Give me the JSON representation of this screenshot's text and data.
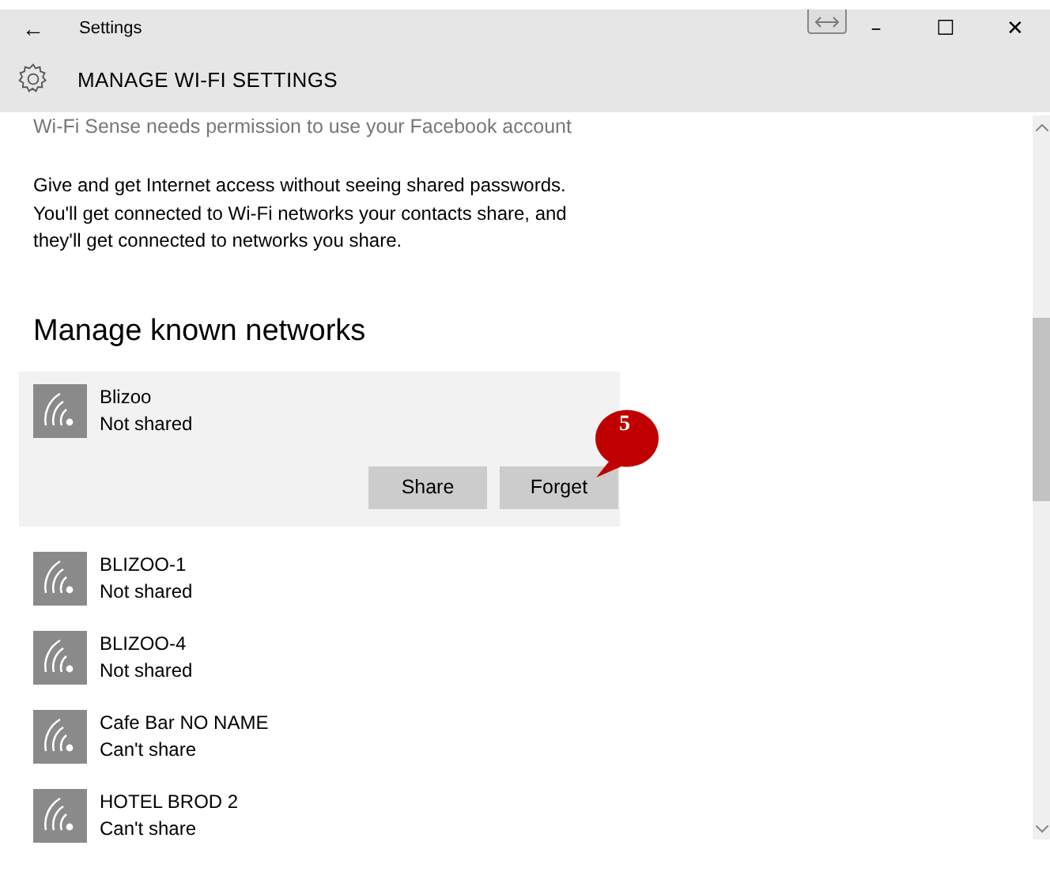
{
  "window": {
    "title": "Settings",
    "back": "←",
    "controls": [
      "–",
      "☐",
      "✕"
    ]
  },
  "header": {
    "title": "MANAGE WI-FI SETTINGS"
  },
  "permission_note": "Wi-Fi Sense needs permission to use your Facebook account",
  "description": "Give and get Internet access without seeing shared passwords. You'll get connected to Wi-Fi networks your contacts share, and they'll get connected to networks you share.",
  "section_heading": "Manage known networks",
  "networks": [
    {
      "name": "Blizoo",
      "status": "Not shared",
      "selected": true,
      "actions": [
        "Share",
        "Forget"
      ]
    },
    {
      "name": "BLIZOO-1",
      "status": "Not shared",
      "selected": false
    },
    {
      "name": "BLIZOO-4",
      "status": "Not shared",
      "selected": false
    },
    {
      "name": "Cafe Bar NO NAME",
      "status": "Can't share",
      "selected": false
    },
    {
      "name": "HOTEL BROD 2",
      "status": "Can't share",
      "selected": false
    }
  ],
  "callout": {
    "label": "5"
  }
}
